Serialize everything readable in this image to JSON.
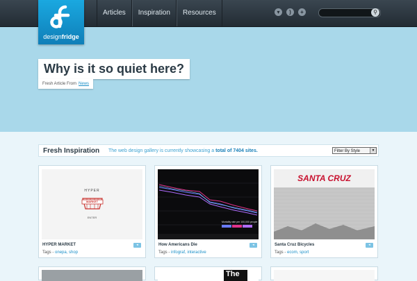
{
  "logo": {
    "text_light": "design",
    "text_bold": "fridge"
  },
  "nav": [
    "Articles",
    "Inspiration",
    "Resources"
  ],
  "header_icons": [
    "twitter-icon",
    "rss-icon",
    "plus-icon"
  ],
  "search": {
    "placeholder": ""
  },
  "hero": {
    "headline": "Why is it so quiet here?",
    "sub_prefix": "Fresh Article From",
    "sub_link": "News",
    "slides": 5,
    "active_slide": 1
  },
  "gallery_bar": {
    "title": "Fresh Inspiration",
    "desc_pre": "The web design gallery is currently showcasing a",
    "desc_bold": "total of 7404 sites.",
    "filter": "Filter By Style"
  },
  "cards": [
    {
      "name": "HYPER MARKET",
      "tags_label": "Tags -",
      "tags": "onepa, shop",
      "thumb_text_top": "HYPER",
      "thumb_text_logo": "MARKET",
      "thumb_text_enter": "ENTER"
    },
    {
      "name": "How Americans Die",
      "tags_label": "Tags -",
      "tags": "infograf, interactive",
      "chart_caption": "Mortality rate per 100,000 people"
    },
    {
      "name": "Santa Cruz Bicycles",
      "tags_label": "Tags -",
      "tags": "ecom, sport",
      "thumb_text_logo": "SANTA CRUZ"
    }
  ],
  "row2_card_text": "The",
  "colors": {
    "accent": "#1a8fc8",
    "hero_bg": "#a9d8ea",
    "topbar": "#2b353e"
  }
}
